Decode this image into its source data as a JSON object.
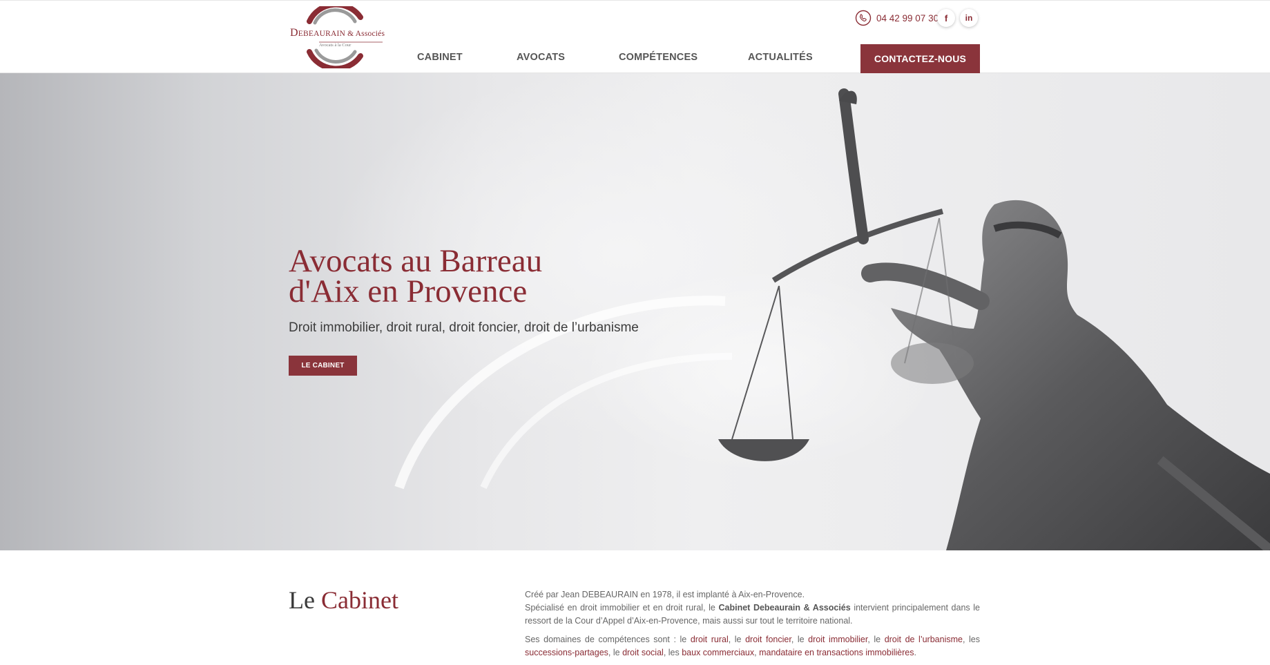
{
  "header": {
    "logo": {
      "name_initial": "D",
      "name_rest": "EBEAURAIN",
      "name_suffix": "& Associés",
      "subtitle": "Avocats à la Cour"
    },
    "phone": "04 42 99 07 30",
    "social": {
      "facebook": "f",
      "linkedin": "in"
    },
    "nav": [
      {
        "label": "CABINET"
      },
      {
        "label": "AVOCATS"
      },
      {
        "label": "COMPÉTENCES"
      },
      {
        "label": "ACTUALITÉS"
      }
    ],
    "cta_label": "CONTACTEZ-NOUS"
  },
  "hero": {
    "title_line1": "Avocats au Barreau",
    "title_line2": "d'Aix en Provence",
    "subtitle": "Droit immobilier, droit rural, droit foncier, droit de l’urbanisme",
    "button_label": "LE CABINET"
  },
  "cabinet": {
    "title_plain": "Le ",
    "title_accent": "Cabinet",
    "p1_line1": "Créé par Jean DEBEAURAIN en 1978, il est implanté à Aix-en-Provence.",
    "p1_line2_a": "Spécialisé en droit immobilier et en droit rural, le ",
    "p1_line2_strong": "Cabinet Debeaurain & Associés",
    "p1_line2_b": " intervient principalement dans le ressort de la Cour d’Appel d’Aix-en-Provence, mais aussi sur tout le territoire national.",
    "p2": {
      "lead": "Ses domaines de compétences sont : le ",
      "l1": "droit rural",
      "s1": ", le ",
      "l2": "droit foncier",
      "s2": ", le ",
      "l3": "droit immobilier",
      "s3": ", le ",
      "l4": "droit de l’urbanisme",
      "s4": ", les ",
      "l5": "successions-partages",
      "s5": ",  le ",
      "l6": "droit social",
      "s6": ", les ",
      "l7": "baux commerciaux",
      "s7": ", ",
      "l8": "mandataire en transactions immobilières",
      "s8": "."
    }
  },
  "colors": {
    "brand": "#8a2c34",
    "button": "#8a343b",
    "text": "#555555"
  }
}
